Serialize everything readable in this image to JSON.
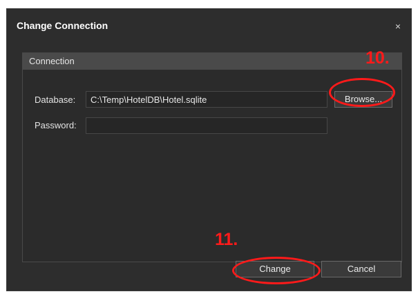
{
  "dialog": {
    "title": "Change Connection",
    "close_glyph": "×"
  },
  "connection": {
    "header": "Connection",
    "database_label": "Database:",
    "database_value": "C:\\Temp\\HotelDB\\Hotel.sqlite",
    "password_label": "Password:",
    "password_value": "",
    "browse_label": "Browse..."
  },
  "footer": {
    "change_label": "Change",
    "cancel_label": "Cancel"
  },
  "annotations": {
    "step_browse": "10.",
    "step_change": "11.",
    "color": "#ff1a1a"
  },
  "icons": {
    "close": "close-icon"
  }
}
